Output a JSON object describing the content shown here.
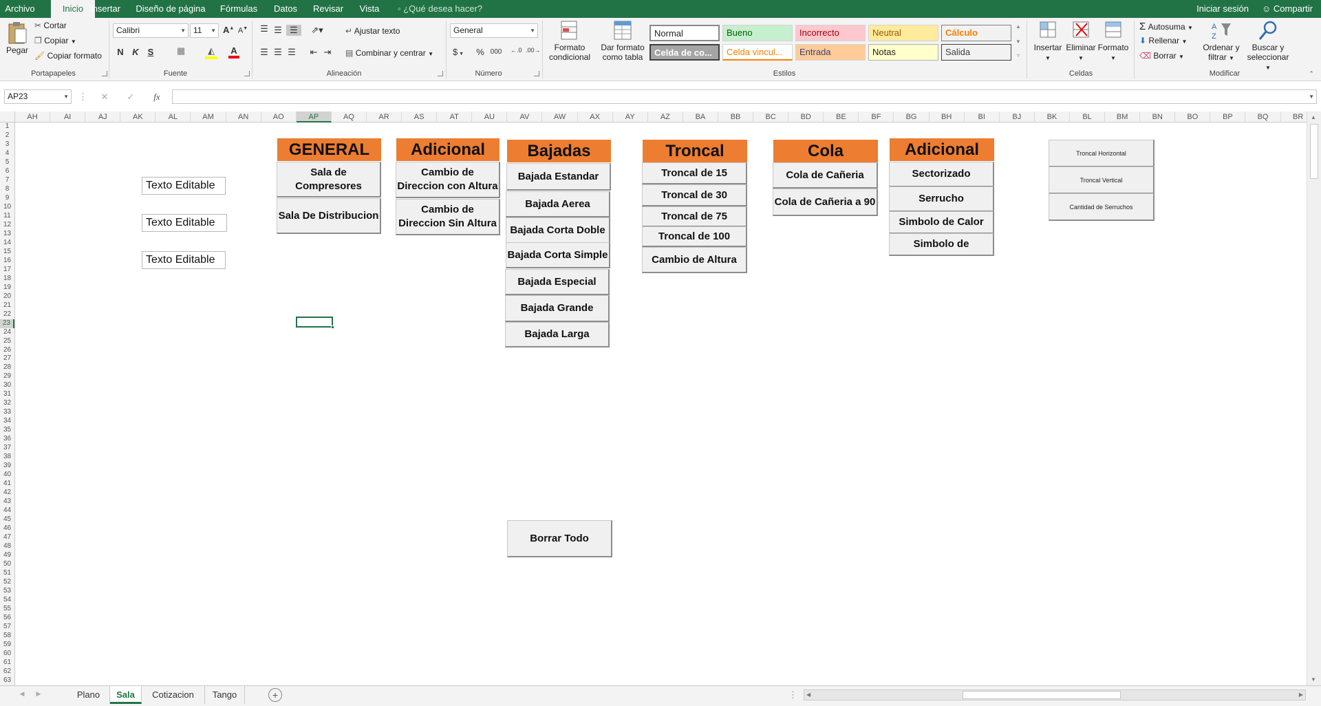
{
  "ribbon_tabs": [
    "Archivo",
    "Inicio",
    "Insertar",
    "Diseño de página",
    "Fórmulas",
    "Datos",
    "Revisar",
    "Vista"
  ],
  "tell_me": "¿Qué desea hacer?",
  "account": {
    "signin": "Iniciar sesión",
    "share": "Compartir"
  },
  "clipboard": {
    "paste": "Pegar",
    "cut": "Cortar",
    "copy": "Copiar",
    "format_painter": "Copiar formato",
    "label": "Portapapeles"
  },
  "font": {
    "name": "Calibri",
    "size": "11",
    "bold": "N",
    "italic": "K",
    "underline": "S",
    "label": "Fuente"
  },
  "alignment": {
    "wrap": "Ajustar texto",
    "merge": "Combinar y centrar",
    "label": "Alineación"
  },
  "number": {
    "format": "General",
    "currency": "$",
    "percent": "%",
    "thousands": "000",
    "label": "Número"
  },
  "styles": {
    "conditional": "Formato condicional",
    "as_table": "Dar formato como tabla",
    "label": "Estilos",
    "cells": [
      "Normal",
      "Bueno",
      "Incorrecto",
      "Neutral",
      "Cálculo",
      "Celda de co...",
      "Celda vincul...",
      "Entrada",
      "Notas",
      "Salida"
    ]
  },
  "cells_group": {
    "insert": "Insertar",
    "delete": "Eliminar",
    "format": "Formato",
    "label": "Celdas"
  },
  "modify": {
    "autosum": "Autosuma",
    "fill": "Rellenar",
    "clear": "Borrar",
    "sort": "Ordenar y filtrar",
    "find": "Buscar y seleccionar",
    "label": "Modificar"
  },
  "formula_bar": {
    "name_box": "AP23",
    "fx": "fx",
    "cancel": "✕",
    "enter": "✓",
    "value": ""
  },
  "columns": [
    "AH",
    "AI",
    "AJ",
    "AK",
    "AL",
    "AM",
    "AN",
    "AO",
    "AP",
    "AQ",
    "AR",
    "AS",
    "AT",
    "AU",
    "AV",
    "AW",
    "AX",
    "AY",
    "AZ",
    "BA",
    "BB",
    "BC",
    "BD",
    "BE",
    "BF",
    "BG",
    "BH",
    "BI",
    "BJ",
    "BK",
    "BL",
    "BM",
    "BN",
    "BO",
    "BP",
    "BQ",
    "BR"
  ],
  "selected_column": "AP",
  "selected_row": 23,
  "text_boxes": [
    "Texto Editable",
    "Texto Editable",
    "Texto Editable"
  ],
  "panels": {
    "general": {
      "title": "GENERAL",
      "items": [
        "Sala de Compresores",
        "Sala De Distribucion"
      ]
    },
    "adicional1": {
      "title": "Adicional",
      "items": [
        "Cambio de Direccion con Altura",
        "Cambio de Direccion Sin Altura"
      ]
    },
    "bajadas": {
      "title": "Bajadas",
      "items": [
        "Bajada Estandar",
        "Bajada Aerea",
        "Bajada Corta Doble",
        "Bajada Corta Simple",
        "Bajada Especial",
        "Bajada Grande",
        "Bajada Larga"
      ]
    },
    "troncal": {
      "title": "Troncal",
      "items": [
        "Troncal de 15",
        "Troncal de 30",
        "Troncal de 75",
        "Troncal de 100",
        "Cambio de Altura"
      ]
    },
    "cola": {
      "title": "Cola",
      "items": [
        "Cola de Cañeria",
        "Cola de Cañeria a 90"
      ]
    },
    "adicional2": {
      "title": "Adicional",
      "items": [
        "Sectorizado",
        "Serrucho",
        "Simbolo de Calor",
        "Simbolo de"
      ]
    }
  },
  "small_buttons": [
    "Troncal Horizontal",
    "Troncal Vertical",
    "Cantidad de Serruchos"
  ],
  "clear_all": "Borrar Todo",
  "sheets": [
    "Plano",
    "Sala",
    "Cotizacion",
    "Tango"
  ],
  "active_sheet": "Sala"
}
